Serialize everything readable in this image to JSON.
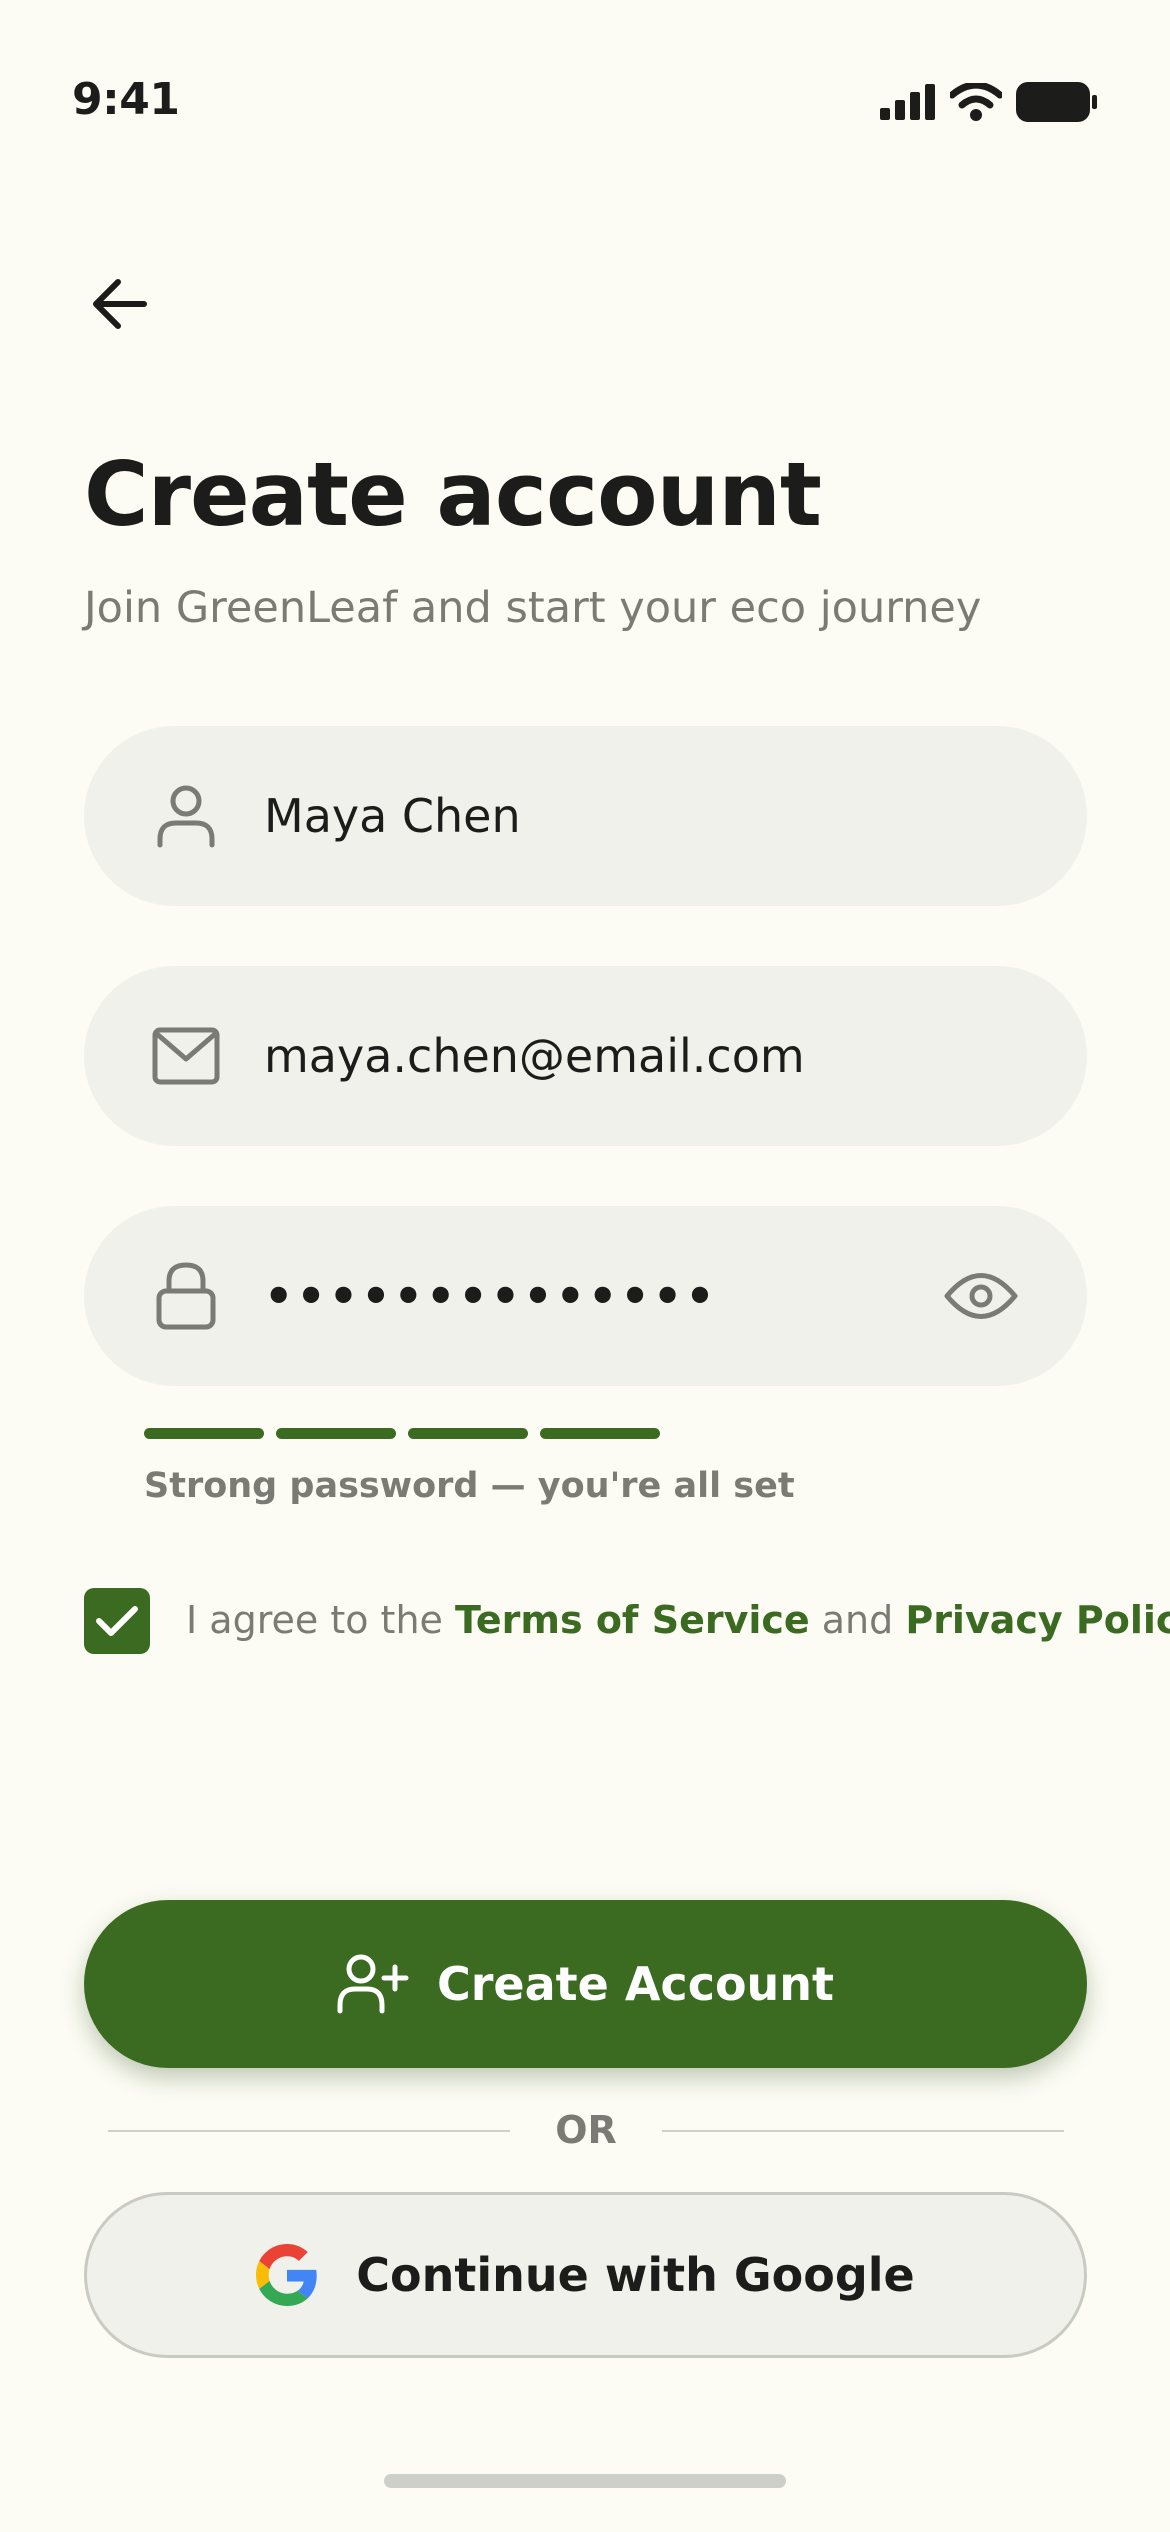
{
  "status_bar": {
    "time": "9:41",
    "icons": [
      "signal-icon",
      "wifi-icon",
      "battery-icon"
    ]
  },
  "header": {
    "back_icon": "arrow-left-icon",
    "title": "Create account",
    "subtitle": "Join GreenLeaf and start your eco journey"
  },
  "form": {
    "name": {
      "icon": "user-icon",
      "value": "Maya Chen"
    },
    "email": {
      "icon": "mail-icon",
      "value": "maya.chen@email.com"
    },
    "password": {
      "icon": "lock-icon",
      "value": "••••••••••••••",
      "toggle_icon": "eye-icon",
      "strength_segments_filled": 4,
      "strength_text": "Strong password — you're all set"
    },
    "terms": {
      "checked": true,
      "prefix": "I agree to the ",
      "terms_link": "Terms of Service",
      "middle": " and ",
      "privacy_link": "Privacy Policy"
    }
  },
  "actions": {
    "create_label": "Create Account",
    "create_icon": "user-plus-icon",
    "divider_label": "OR",
    "google_label": "Continue with Google",
    "google_icon": "google-icon"
  },
  "colors": {
    "background": "#FCFCF4",
    "primary": "#3A6B21",
    "field": "#EFF1EA",
    "muted_text": "#7A7B74"
  }
}
